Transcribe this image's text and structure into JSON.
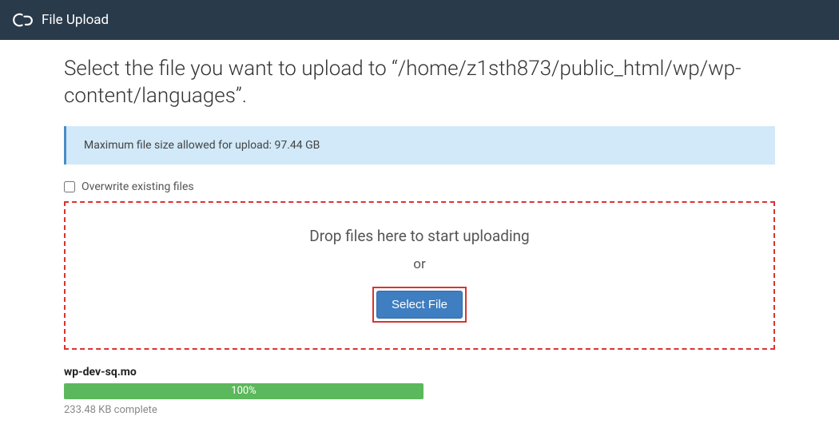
{
  "header": {
    "title": "File Upload"
  },
  "page": {
    "title": "Select the file you want to upload to “/home/z1sth873/public_html/wp/wp-content/languages”."
  },
  "info": {
    "message": "Maximum file size allowed for upload: 97.44 GB"
  },
  "overwrite": {
    "label": "Overwrite existing files",
    "checked": false
  },
  "dropzone": {
    "text": "Drop files here to start uploading",
    "or": "or",
    "select_label": "Select File"
  },
  "upload": {
    "file_name": "wp-dev-sq.mo",
    "percent_label": "100%",
    "percent_value": 100,
    "status": "233.48 KB complete"
  }
}
